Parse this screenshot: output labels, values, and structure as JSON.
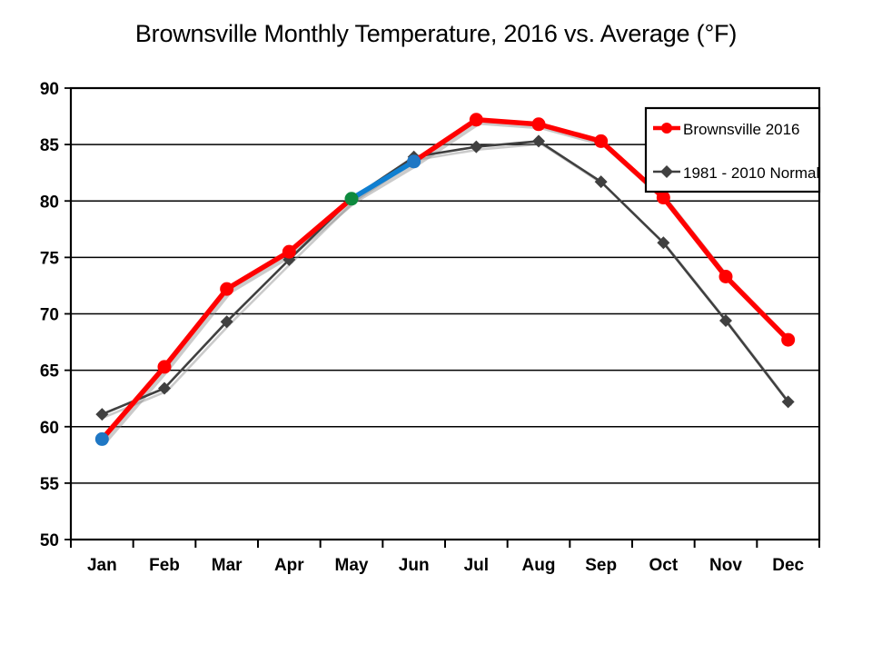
{
  "chart_data": {
    "type": "line",
    "title": "Brownsville Monthly Temperature, 2016 vs. Average (°F)",
    "xlabel": "",
    "ylabel": "",
    "ylim": [
      50,
      90
    ],
    "ytick_step": 5,
    "yticks": [
      "50",
      "55",
      "60",
      "65",
      "70",
      "75",
      "80",
      "85",
      "90"
    ],
    "grid": "horizontal",
    "legend_position": "top-right-inside",
    "categories": [
      "Jan",
      "Feb",
      "Mar",
      "Apr",
      "May",
      "Jun",
      "Jul",
      "Aug",
      "Sep",
      "Oct",
      "Nov",
      "Dec"
    ],
    "series": [
      {
        "name": "Brownsville 2016",
        "color": "#FF0000",
        "marker": "circle",
        "values": [
          58.9,
          65.3,
          72.2,
          75.5,
          80.2,
          83.5,
          87.2,
          86.8,
          85.3,
          80.3,
          73.3,
          67.7
        ],
        "point_colors": [
          "#1F77C4",
          "#FF0000",
          "#FF0000",
          "#FF0000",
          "#0E8A3E",
          "#1F77C4",
          "#FF0000",
          "#FF0000",
          "#FF0000",
          "#FF0000",
          "#FF0000",
          "#FF0000"
        ],
        "segment_colors": [
          "#FF0000",
          "#FF0000",
          "#FF0000",
          "#FF0000",
          "#0F7FD1",
          "#FF0000",
          "#FF0000",
          "#FF0000",
          "#FF0000",
          "#FF0000",
          "#FF0000"
        ]
      },
      {
        "name": "1981 - 2010 Normal",
        "color": "#404040",
        "marker": "diamond",
        "values": [
          61.1,
          63.4,
          69.3,
          74.8,
          80.2,
          83.9,
          84.8,
          85.3,
          81.7,
          76.3,
          69.4,
          62.2
        ],
        "point_colors": [
          "#404040",
          "#404040",
          "#404040",
          "#404040",
          "#404040",
          "#404040",
          "#404040",
          "#404040",
          "#404040",
          "#404040",
          "#404040",
          "#404040"
        ],
        "segment_colors": [
          "#404040",
          "#404040",
          "#404040",
          "#404040",
          "#404040",
          "#404040",
          "#404040",
          "#404040",
          "#404040",
          "#404040",
          "#404040"
        ]
      }
    ],
    "colors": {
      "series_2016": "#FF0000",
      "series_normal": "#404040",
      "highlight_start": "#0E8A3E",
      "highlight_end": "#1F77C4",
      "highlight_segment": "#0F7FD1",
      "axis": "#000000",
      "gridline": "#000000",
      "background": "#FFFFFF"
    }
  },
  "legend": {
    "entries": [
      {
        "label": "Brownsville 2016"
      },
      {
        "label": "1981 - 2010 Normal"
      }
    ]
  }
}
